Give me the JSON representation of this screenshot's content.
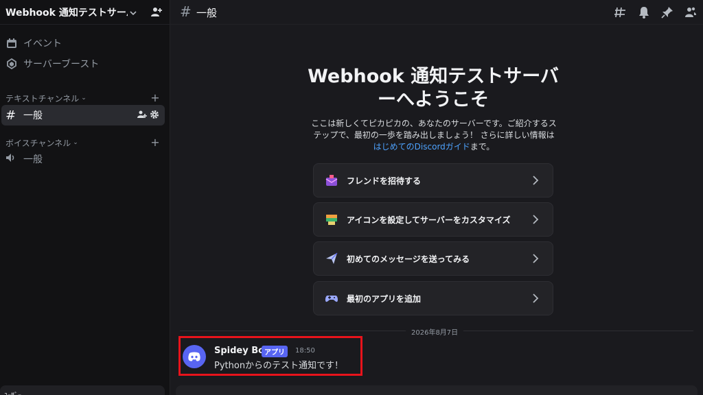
{
  "server": {
    "name": "Webhook 通知テストサーバー"
  },
  "sidebar": {
    "nav": [
      {
        "label": "イベント",
        "icon": "calendar-icon"
      },
      {
        "label": "サーバーブースト",
        "icon": "boost-icon"
      }
    ],
    "text_category": "テキストチャンネル",
    "voice_category": "ボイスチャンネル",
    "text_channels": [
      {
        "label": "一般",
        "active": true
      }
    ],
    "voice_channels": [
      {
        "label": "一般"
      }
    ],
    "user_panel_text": "ﾕｰｻﾞｰ"
  },
  "topbar": {
    "channel": "一般"
  },
  "welcome": {
    "title": "Webhook 通知テストサーバーへようこそ",
    "desc_before": "ここは新しくてピカピカの、あなたのサーバーです。ご紹介するステップで、最初の一歩を踏み出しましょう！ さらに詳しい情報は",
    "desc_link": "はじめてのDiscordガイド",
    "desc_after": "まで。",
    "cards": [
      {
        "label": "フレンドを招待する",
        "icon": "invite-icon"
      },
      {
        "label": "アイコンを設定してサーバーをカスタマイズ",
        "icon": "customize-icon"
      },
      {
        "label": "初めてのメッセージを送ってみる",
        "icon": "send-icon"
      },
      {
        "label": "最初のアプリを追加",
        "icon": "gamepad-icon"
      }
    ]
  },
  "date_divider": "2026年8月7日",
  "message": {
    "author": "Spidey Bot",
    "badge": "アプリ",
    "time": "18:50",
    "text": "Pythonからのテスト通知です！"
  },
  "colors": {
    "accent": "#5865f2",
    "link": "#4ea3ff",
    "highlight": "#e8131b"
  }
}
